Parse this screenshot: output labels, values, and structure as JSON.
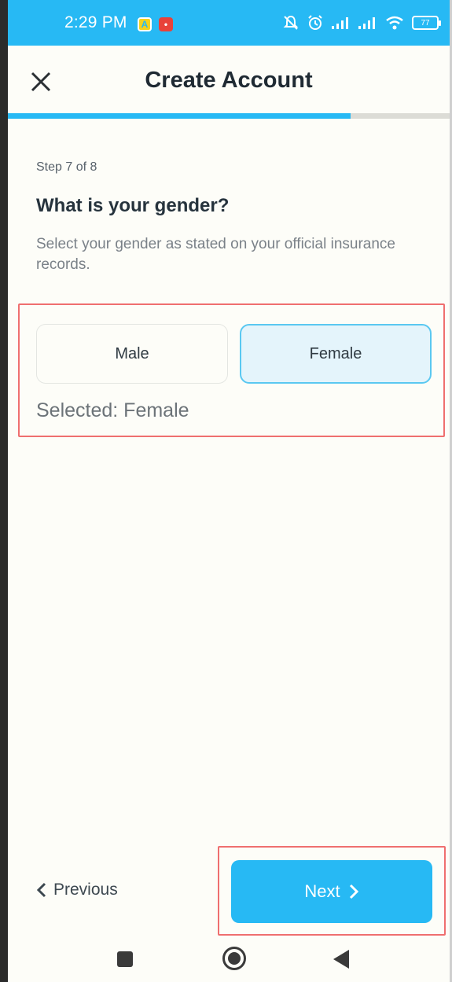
{
  "status_bar": {
    "time": "2:29 PM",
    "battery": "77",
    "icons": [
      "mute-icon",
      "alarm-icon",
      "signal-icon",
      "signal-icon",
      "wifi-icon",
      "battery-icon"
    ]
  },
  "app_bar": {
    "title": "Create Account",
    "close_icon": "close-icon"
  },
  "progress": {
    "value": 0.775,
    "color": "#27b9f4"
  },
  "step_label": "Step 7 of 8",
  "question": "What is your gender?",
  "description": "Select your gender as stated on your official insurance records.",
  "gender_options": [
    {
      "label": "Male",
      "selected": false
    },
    {
      "label": "Female",
      "selected": true
    }
  ],
  "selected_text": "Selected: Female",
  "nav": {
    "previous_label": "Previous",
    "next_label": "Next"
  },
  "colors": {
    "accent": "#27b9f4",
    "highlight_border": "#ef6f6f",
    "selected_bg": "#e4f4fb"
  }
}
